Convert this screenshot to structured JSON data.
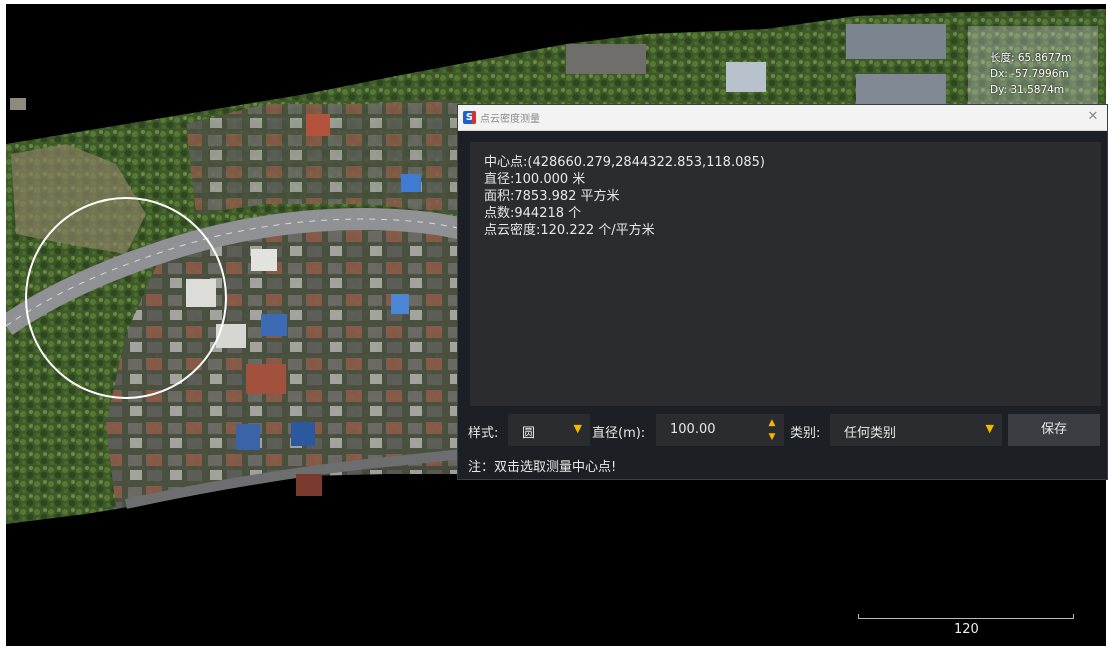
{
  "measurement": {
    "length": "长度: 65.8677m",
    "dx": "Dx: -57.7996m",
    "dy": "Dy: 31.5874m"
  },
  "scale": {
    "label": "120"
  },
  "dialog": {
    "title": "点云密度测量",
    "close_glyph": "✕",
    "app_icon_letter": "S",
    "results": [
      "中心点:(428660.279,2844322.853,118.085)",
      "直径:100.000 米",
      "面积:7853.982 平方米",
      "点数:944218 个",
      "点云密度:120.222 个/平方米"
    ],
    "controls": {
      "style_label": "样式:",
      "style_value": "圆",
      "diameter_label": "直径(m):",
      "diameter_value": "100.00",
      "category_label": "类别:",
      "category_value": "任何类别",
      "save_label": "保存"
    },
    "note": "注：双击选取测量中心点!"
  },
  "colors": {
    "accent": "#f5b800",
    "dialog_bg": "#1c1f23",
    "panel_bg": "#2a2c30"
  },
  "icons": {
    "dropdown": "chevron-down-icon",
    "spin_up": "triangle-up-icon",
    "spin_down": "triangle-down-icon",
    "close": "close-icon",
    "app": "app-logo-icon"
  }
}
